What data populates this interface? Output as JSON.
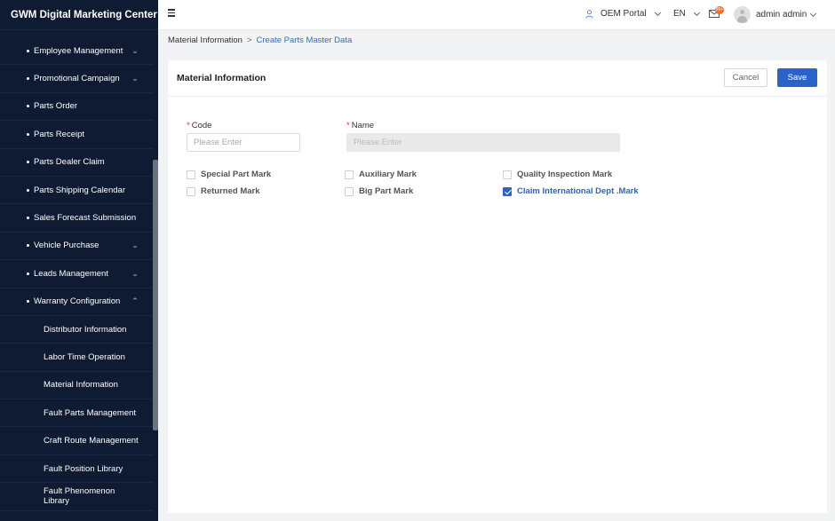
{
  "app": {
    "title": "GWM Digital Marketing Center"
  },
  "topbar": {
    "portal": "OEM Portal",
    "language": "EN",
    "mail_badge": "99+",
    "user": "admin admin"
  },
  "sidebar": {
    "items": [
      {
        "label": "Employee Management",
        "chevron": "down"
      },
      {
        "label": "Promotional Campaign",
        "chevron": "down"
      },
      {
        "label": "Parts Order",
        "chevron": ""
      },
      {
        "label": "Parts Receipt",
        "chevron": ""
      },
      {
        "label": "Parts Dealer Claim",
        "chevron": ""
      },
      {
        "label": "Parts Shipping Calendar",
        "chevron": ""
      },
      {
        "label": "Sales Forecast Submission",
        "chevron": ""
      },
      {
        "label": "Vehicle Purchase",
        "chevron": "down"
      },
      {
        "label": "Leads Management",
        "chevron": "down"
      },
      {
        "label": "Warranty Configuration",
        "chevron": "up"
      }
    ],
    "subitems": [
      {
        "label": "Distributor Information"
      },
      {
        "label": "Labor Time Operation"
      },
      {
        "label": "Material Information"
      },
      {
        "label": "Fault Parts Management"
      },
      {
        "label": "Craft Route Management"
      },
      {
        "label": "Fault Position Library"
      },
      {
        "label": "Fault Phenomenon Library"
      }
    ]
  },
  "breadcrumb": {
    "parent": "Material Information",
    "separator": ">",
    "current": "Create Parts Master Data"
  },
  "card": {
    "title": "Material Information",
    "cancel_label": "Cancel",
    "save_label": "Save"
  },
  "form": {
    "code": {
      "label": "Code",
      "required": "*",
      "placeholder": "Please Enter",
      "value": ""
    },
    "name": {
      "label": "Name",
      "required": "*",
      "placeholder": "Please Enter",
      "value": "",
      "disabled": true
    },
    "checkboxes": [
      {
        "label": "Special Part Mark",
        "checked": false
      },
      {
        "label": "Auxiliary Mark",
        "checked": false
      },
      {
        "label": "Quality Inspection Mark",
        "checked": false
      },
      {
        "label": "Returned Mark",
        "checked": false
      },
      {
        "label": "Big Part Mark",
        "checked": false
      },
      {
        "label": "Claim International Dept .Mark",
        "checked": true
      }
    ]
  },
  "colors": {
    "sidebar_bg": "#0f1a33",
    "accent": "#2a64c8",
    "required": "#ee3333",
    "badge": "#f56c2d"
  }
}
